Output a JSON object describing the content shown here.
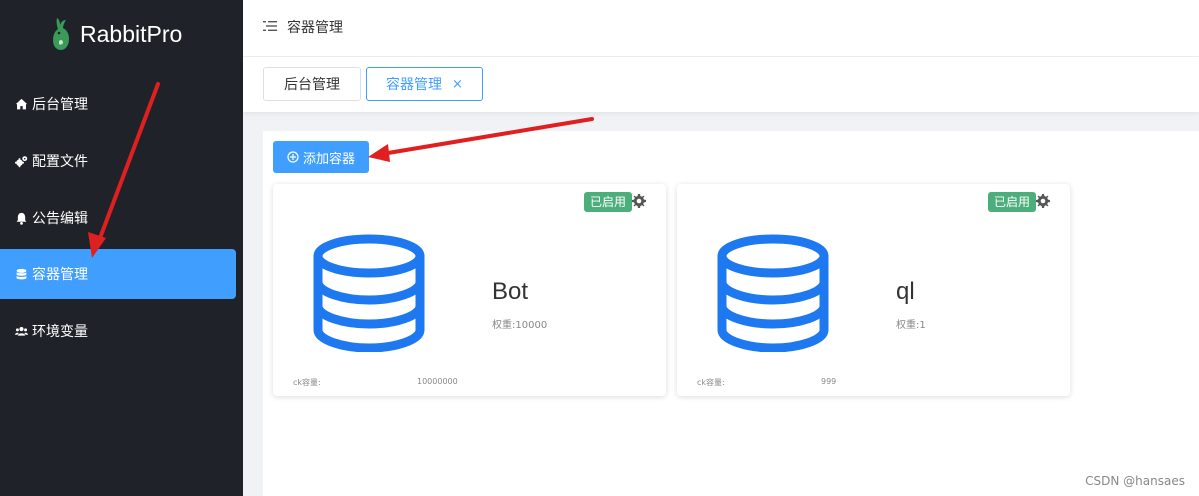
{
  "app": {
    "brand": "RabbitPro"
  },
  "sidebar": {
    "items": [
      {
        "label": "后台管理",
        "icon": "home-icon"
      },
      {
        "label": "配置文件",
        "icon": "gears-icon"
      },
      {
        "label": "公告编辑",
        "icon": "bell-icon"
      },
      {
        "label": "容器管理",
        "icon": "database-icon",
        "active": true
      },
      {
        "label": "环境变量",
        "icon": "users-icon"
      }
    ]
  },
  "header": {
    "title": "容器管理"
  },
  "tabs": [
    {
      "label": "后台管理",
      "active": false
    },
    {
      "label": "容器管理",
      "active": true,
      "close": "×"
    }
  ],
  "toolbar": {
    "add_label": "添加容器"
  },
  "containers": [
    {
      "name": "Bot",
      "weight": "权重:10000",
      "status": "已启用",
      "cap_label": "ck容量:",
      "cap_value": "10000000"
    },
    {
      "name": "ql",
      "weight": "权重:1",
      "status": "已启用",
      "cap_label": "ck容量:",
      "cap_value": "999"
    }
  ],
  "watermark": "CSDN @hansaes",
  "colors": {
    "sidebar_bg": "#1f2329",
    "accent": "#409eff",
    "status_green": "#4cae7a",
    "db_icon": "#1e78f0",
    "annotation_arrow": "#e02020"
  }
}
